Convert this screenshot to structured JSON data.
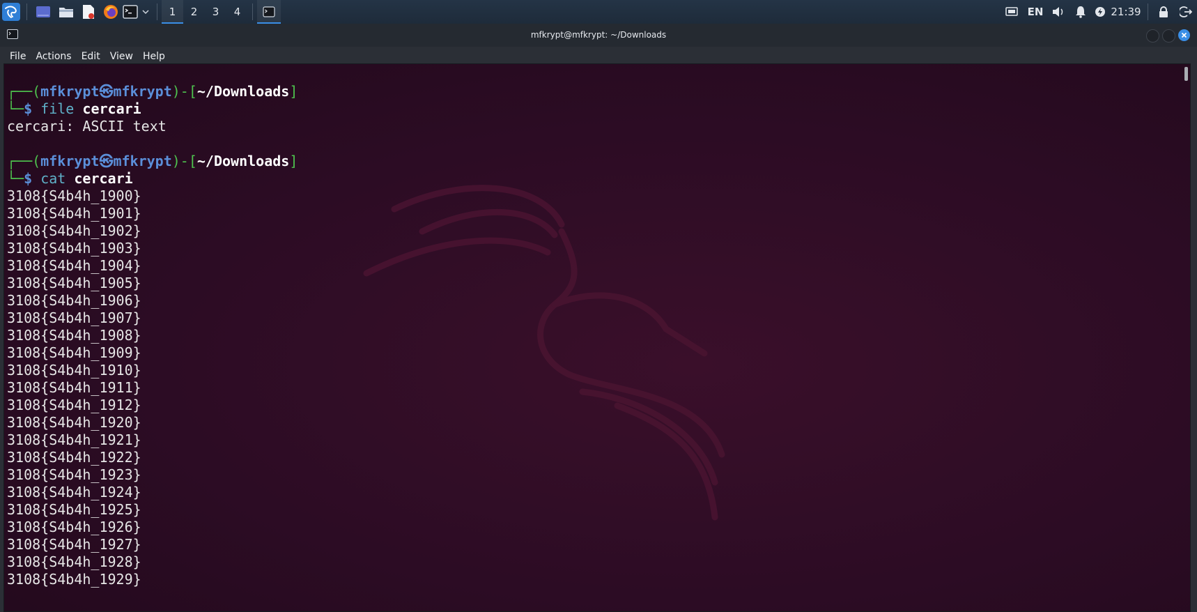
{
  "taskbar": {
    "workspaces": [
      "1",
      "2",
      "3",
      "4"
    ],
    "active_workspace_index": 0,
    "tray": {
      "language": "EN",
      "clock": "21:39"
    }
  },
  "window": {
    "title": "mfkrypt@mfkrypt: ~/Downloads",
    "menu": [
      "File",
      "Actions",
      "Edit",
      "View",
      "Help"
    ]
  },
  "terminal": {
    "sessions": [
      {
        "user": "mfkrypt",
        "host": "mfkrypt",
        "dir": "~/Downloads",
        "command": "file",
        "arg": "cercari",
        "output": [
          "cercari: ASCII text"
        ]
      },
      {
        "user": "mfkrypt",
        "host": "mfkrypt",
        "dir": "~/Downloads",
        "command": "cat",
        "arg": "cercari",
        "output": [
          "3108{S4b4h_1900}",
          "3108{S4b4h_1901}",
          "3108{S4b4h_1902}",
          "3108{S4b4h_1903}",
          "3108{S4b4h_1904}",
          "3108{S4b4h_1905}",
          "3108{S4b4h_1906}",
          "3108{S4b4h_1907}",
          "3108{S4b4h_1908}",
          "3108{S4b4h_1909}",
          "3108{S4b4h_1910}",
          "3108{S4b4h_1911}",
          "3108{S4b4h_1912}",
          "3108{S4b4h_1920}",
          "3108{S4b4h_1921}",
          "3108{S4b4h_1922}",
          "3108{S4b4h_1923}",
          "3108{S4b4h_1924}",
          "3108{S4b4h_1925}",
          "3108{S4b4h_1926}",
          "3108{S4b4h_1927}",
          "3108{S4b4h_1928}",
          "3108{S4b4h_1929}"
        ]
      }
    ]
  }
}
